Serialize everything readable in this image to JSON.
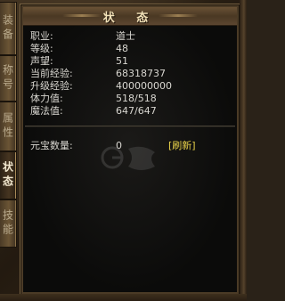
{
  "window": {
    "title": "状 态"
  },
  "tabs": [
    {
      "label": "装备",
      "active": false
    },
    {
      "label": "称号",
      "active": false
    },
    {
      "label": "属性",
      "active": false
    },
    {
      "label": "状态",
      "active": true
    },
    {
      "label": "技能",
      "active": false
    }
  ],
  "stats": [
    {
      "label": "职业:",
      "value": "道士"
    },
    {
      "label": "等级:",
      "value": "48"
    },
    {
      "label": "声望:",
      "value": "51"
    },
    {
      "label": "当前经验:",
      "value": "68318737"
    },
    {
      "label": "升级经验:",
      "value": "400000000"
    },
    {
      "label": "体力值:",
      "value": "518/518"
    },
    {
      "label": "魔法值:",
      "value": "647/647"
    }
  ],
  "currency": {
    "label": "元宝数量:",
    "value": "0",
    "refresh_label": "[刷新]"
  },
  "colors": {
    "text": "#d8d6d0",
    "accent": "#e9d24a",
    "title": "#f3e2b8"
  }
}
